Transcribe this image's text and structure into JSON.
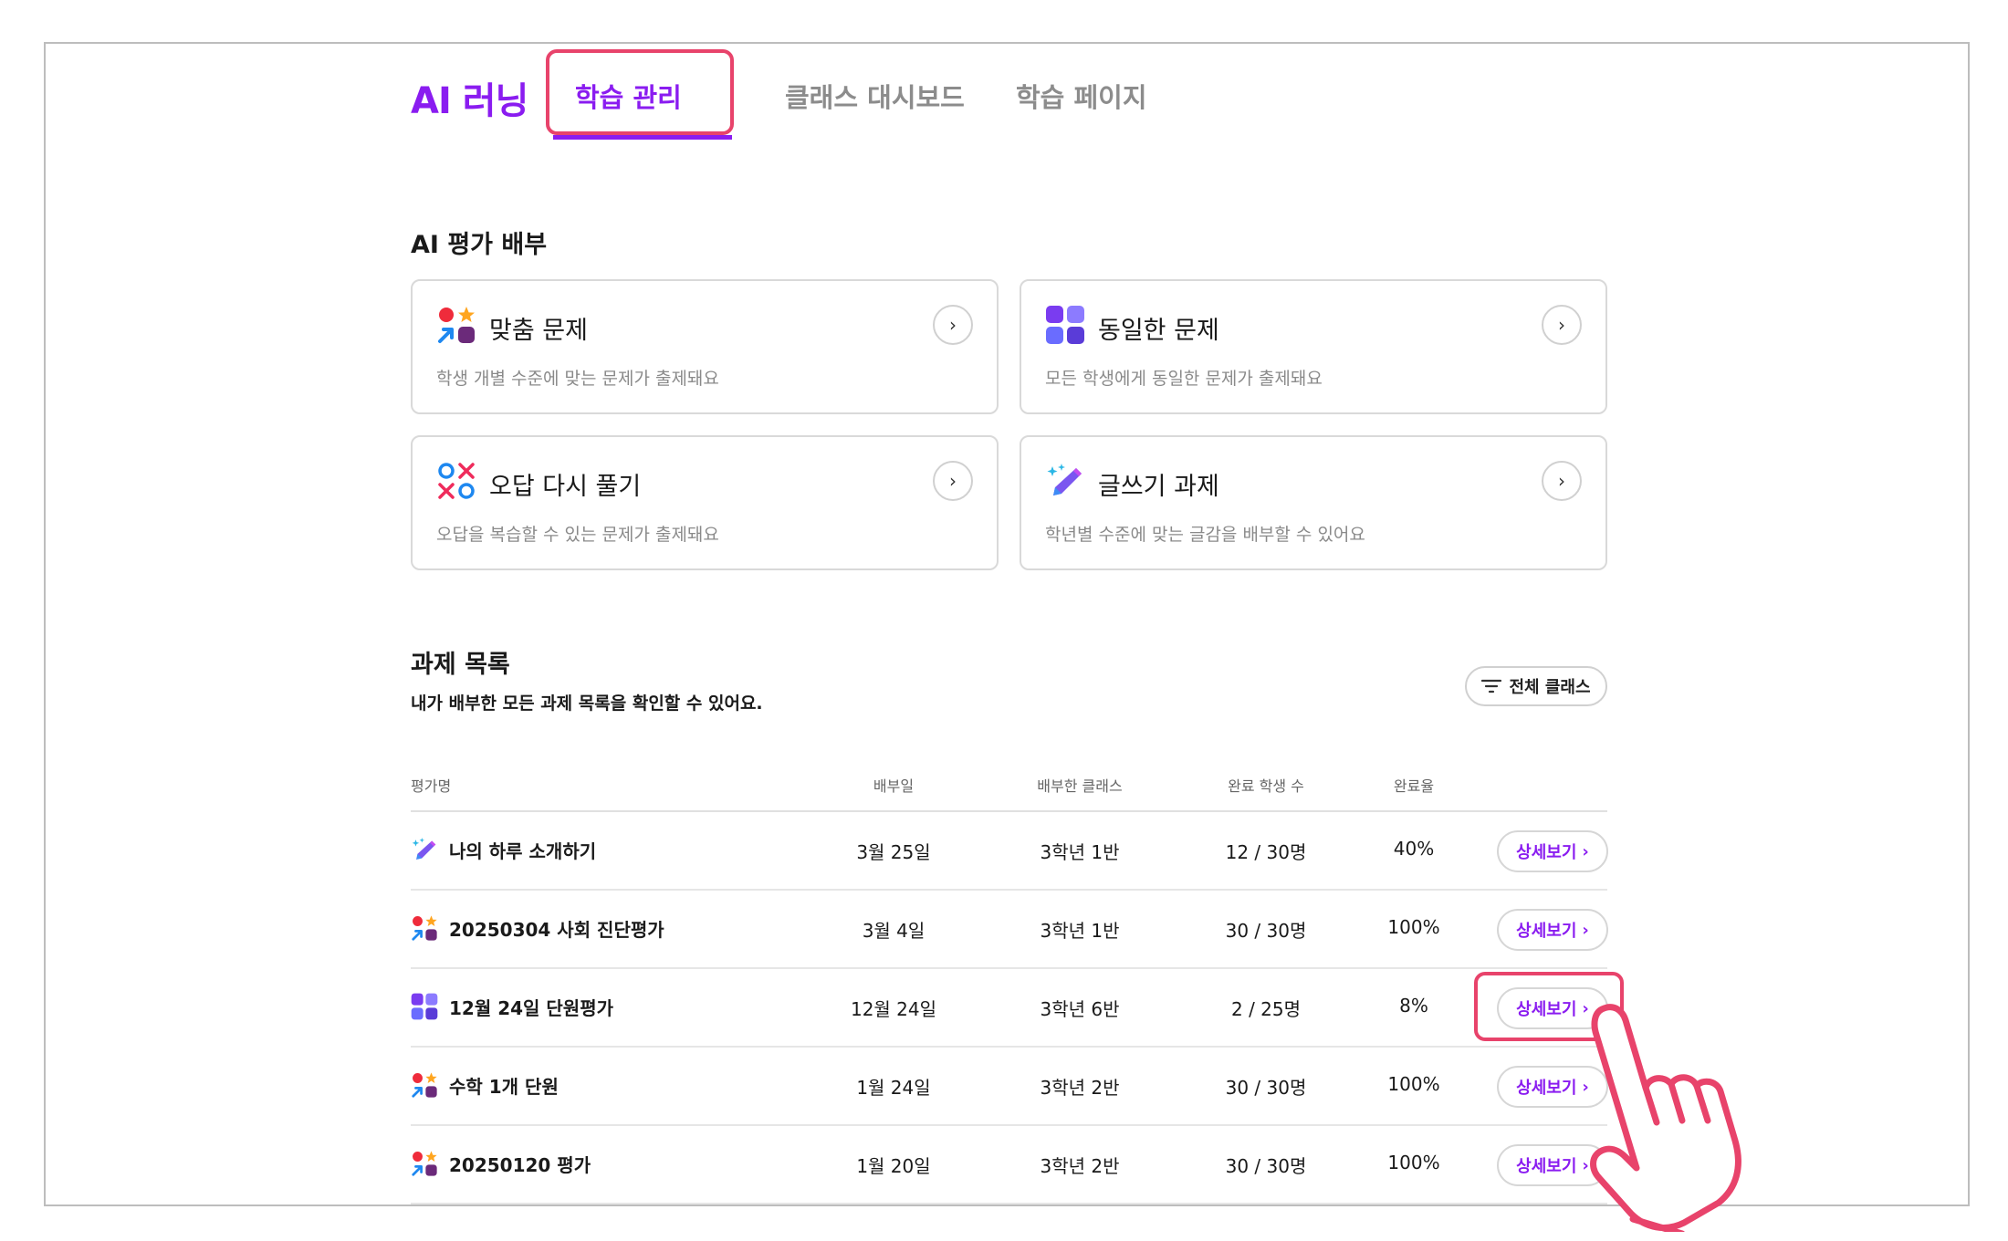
{
  "header": {
    "logo": "AI 러닝",
    "tabs": [
      {
        "label": "학습 관리",
        "active": true
      },
      {
        "label": "클래스 대시보드",
        "active": false
      },
      {
        "label": "학습 페이지",
        "active": false
      }
    ]
  },
  "ai_section": {
    "title": "AI 평가 배부",
    "cards": [
      {
        "icon": "custom-shapes-icon",
        "title": "맞춤 문제",
        "desc": "학생 개별 수준에 맞는 문제가 출제돼요"
      },
      {
        "icon": "grid-squares-icon",
        "title": "동일한 문제",
        "desc": "모든 학생에게 동일한 문제가 출제돼요"
      },
      {
        "icon": "ox-icon",
        "title": "오답 다시 풀기",
        "desc": "오답을 복습할 수 있는 문제가 출제돼요"
      },
      {
        "icon": "pencil-sparkle-icon",
        "title": "글쓰기 과제",
        "desc": "학년별 수준에 맞는 글감을 배부할 수 있어요"
      }
    ]
  },
  "assignments": {
    "title": "과제 목록",
    "desc": "내가 배부한 모든 과제 목록을 확인할 수 있어요.",
    "filter_label": "전체 클래스",
    "columns": [
      "평가명",
      "배부일",
      "배부한 클래스",
      "완료 학생 수",
      "완료율"
    ],
    "detail_label": "상세보기",
    "rows": [
      {
        "icon": "pencil-sparkle-icon",
        "name": "나의 하루 소개하기",
        "date": "3월 25일",
        "class": "3학년 1반",
        "done": "12 / 30명",
        "rate": "40%"
      },
      {
        "icon": "custom-shapes-icon",
        "name": "20250304 사회 진단평가",
        "date": "3월 4일",
        "class": "3학년 1반",
        "done": "30 / 30명",
        "rate": "100%"
      },
      {
        "icon": "grid-squares-icon",
        "name": "12월 24일 단원평가",
        "date": "12월 24일",
        "class": "3학년 6반",
        "done": "2 / 25명",
        "rate": "8%"
      },
      {
        "icon": "custom-shapes-icon",
        "name": "수학 1개 단원",
        "date": "1월 24일",
        "class": "3학년 2반",
        "done": "30 / 30명",
        "rate": "100%"
      },
      {
        "icon": "custom-shapes-icon",
        "name": "20250120 평가",
        "date": "1월 20일",
        "class": "3학년 2반",
        "done": "30 / 30명",
        "rate": "100%"
      }
    ]
  },
  "colors": {
    "accent": "#8a1cf0",
    "highlight": "#e8436b"
  }
}
